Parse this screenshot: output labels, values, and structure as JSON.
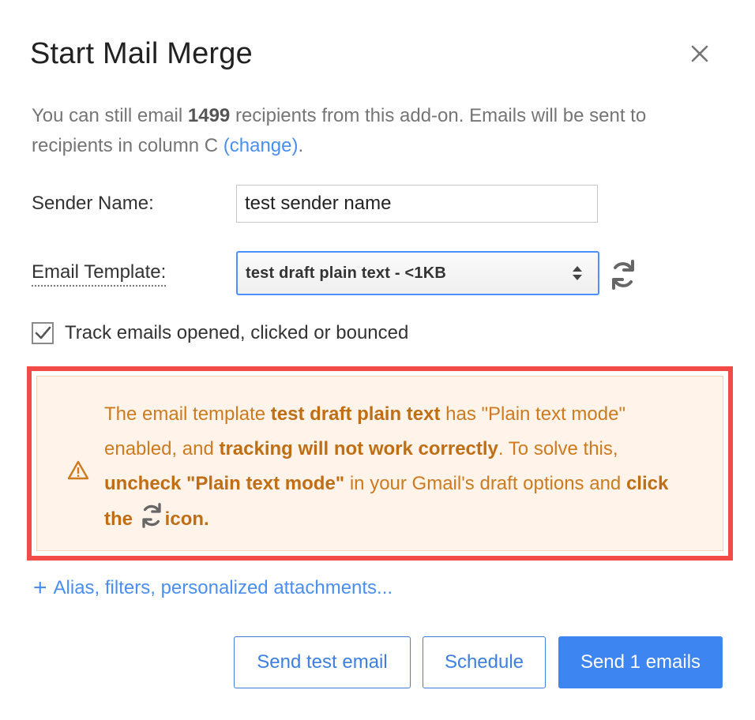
{
  "dialog": {
    "title": "Start Mail Merge"
  },
  "intro": {
    "part1": "You can still email ",
    "count": "1499",
    "part2": " recipients from this add-on. Emails will be sent to recipients in column C ",
    "change_link": "(change)",
    "period": "."
  },
  "form": {
    "sender_label": "Sender Name:",
    "sender_value": "test sender name",
    "template_label": "Email Template:",
    "template_selected": "test draft plain text - <1KB",
    "track_label": "Track emails opened, clicked or bounced",
    "track_checked": true
  },
  "warning": {
    "t1": "The email template ",
    "b1": "test draft plain text",
    "t2": " has \"Plain text mode\" enabled, and ",
    "b2": "tracking will not work correctly",
    "t3": ". To solve this, ",
    "b3": "uncheck \"Plain text mode\"",
    "t4": " in your Gmail's draft options and ",
    "b4": "click the",
    "b5": "icon."
  },
  "more_options": {
    "plus": "+",
    "label": "Alias, filters, personalized attachments..."
  },
  "buttons": {
    "test": "Send test email",
    "schedule": "Schedule",
    "send": "Send 1 emails"
  },
  "colors": {
    "accent": "#3d85f0",
    "link": "#4a8ff0",
    "warning_text": "#cd7b1e",
    "warning_bg": "#fff3ea",
    "highlight_border": "#f24a45"
  },
  "icons": {
    "close": "close-icon",
    "refresh": "refresh-icon",
    "updown": "updown-arrows-icon",
    "check": "checkmark-icon",
    "warning": "warning-triangle-icon"
  }
}
